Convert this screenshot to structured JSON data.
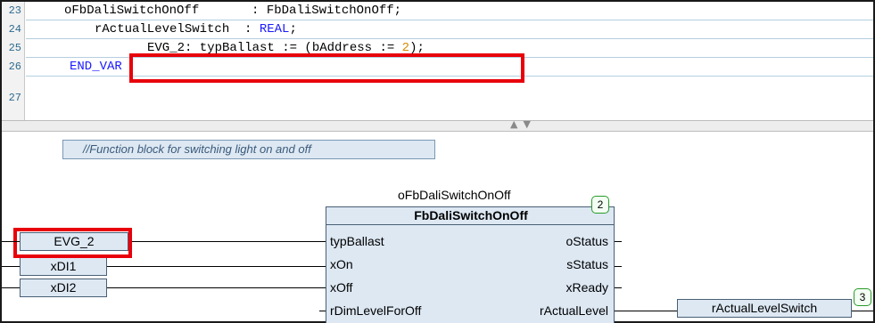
{
  "declaration": {
    "lines": [
      {
        "num": "23",
        "text": "oFbDaliSwitchOnOff       : FbDaliSwitchOnOff;"
      },
      {
        "num": "24",
        "name": "rActualLevelSwitch",
        "sep": "  : ",
        "type": "REAL",
        "end": ";"
      },
      {
        "num": "25",
        "name": "EVG_2: typBallast := (bAddress := ",
        "value": "2",
        "end": ");"
      },
      {
        "num": "26",
        "keyword": "END_VAR"
      },
      {
        "num": "27"
      }
    ]
  },
  "diagram": {
    "comment": "//Function block for switching light on and off",
    "instance_name": "oFbDaliSwitchOnOff",
    "fb_type": "FbDaliSwitchOnOff",
    "fb_badge": "2",
    "inputs": [
      "typBallast",
      "xOn",
      "xOff",
      "rDimLevelForOff"
    ],
    "outputs": [
      "oStatus",
      "sStatus",
      "xReady",
      "rActualLevel"
    ],
    "input_vars": [
      "EVG_2",
      "xDI1",
      "xDI2"
    ],
    "output_var": "rActualLevelSwitch",
    "output_badge": "3"
  },
  "colors": {
    "highlight": "#e8000b",
    "keyword": "#1a1aff",
    "number": "#d68a00",
    "block_fill": "#dde8f3"
  },
  "icons": [
    "splitter-arrows-icon"
  ]
}
